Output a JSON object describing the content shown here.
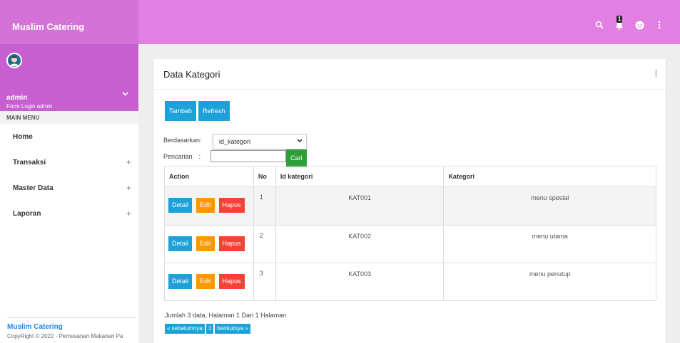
{
  "app": {
    "brand": "Muslim Catering",
    "notification_count": "1"
  },
  "user": {
    "name": "admin",
    "role": "Form Login admin"
  },
  "sidebar": {
    "section_title": "MAIN MENU",
    "items": [
      {
        "label": "Home",
        "expandable": false
      },
      {
        "label": "Transaksi",
        "expandable": true,
        "toggle": "+"
      },
      {
        "label": "Master Data",
        "expandable": true,
        "toggle": "+"
      },
      {
        "label": "Laporan",
        "expandable": true,
        "toggle": "+"
      }
    ],
    "footer": {
      "name": "Muslim Catering",
      "copyright": "CopyRight © 2022 - Pemesanan Makanan Pa"
    }
  },
  "card": {
    "title": "Data Kategori"
  },
  "toolbar": {
    "add_label": "Tambah",
    "refresh_label": "Refresh"
  },
  "filter": {
    "by_label": "Berdasarkan:",
    "selected_option": "id_kategori",
    "search_label": "Pencarian",
    "search_colon": ":",
    "search_value": "",
    "search_button": "Cari"
  },
  "table": {
    "headers": [
      "Action",
      "No",
      "Id kategori",
      "Kategori"
    ],
    "action_labels": {
      "detail": "Detail",
      "edit": "Edit",
      "delete": "Hapus"
    },
    "rows": [
      {
        "no": "1",
        "id": "KAT001",
        "kategori": "menu spesial"
      },
      {
        "no": "2",
        "id": "KAT002",
        "kategori": "menu utama"
      },
      {
        "no": "3",
        "id": "KAT003",
        "kategori": "menu penutup"
      }
    ]
  },
  "pagination": {
    "info": "Jumlah 3 data, Halaman 1 Dari 1 Halaman",
    "prev": "« sebelumnya",
    "current": "1",
    "next": "berikutnya »"
  },
  "colors": {
    "topbar": "#e17fe3",
    "brand_bg": "#d572d7",
    "user_panel": "#c75fd0",
    "info": "#1da1d8",
    "warning": "#ff9800",
    "danger": "#f44336",
    "success": "#2e9e37"
  },
  "icons": [
    "search-icon",
    "bell-icon",
    "emoji-icon",
    "more-vertical-icon",
    "user-avatar-icon",
    "chevron-down-icon",
    "plus-icon"
  ]
}
